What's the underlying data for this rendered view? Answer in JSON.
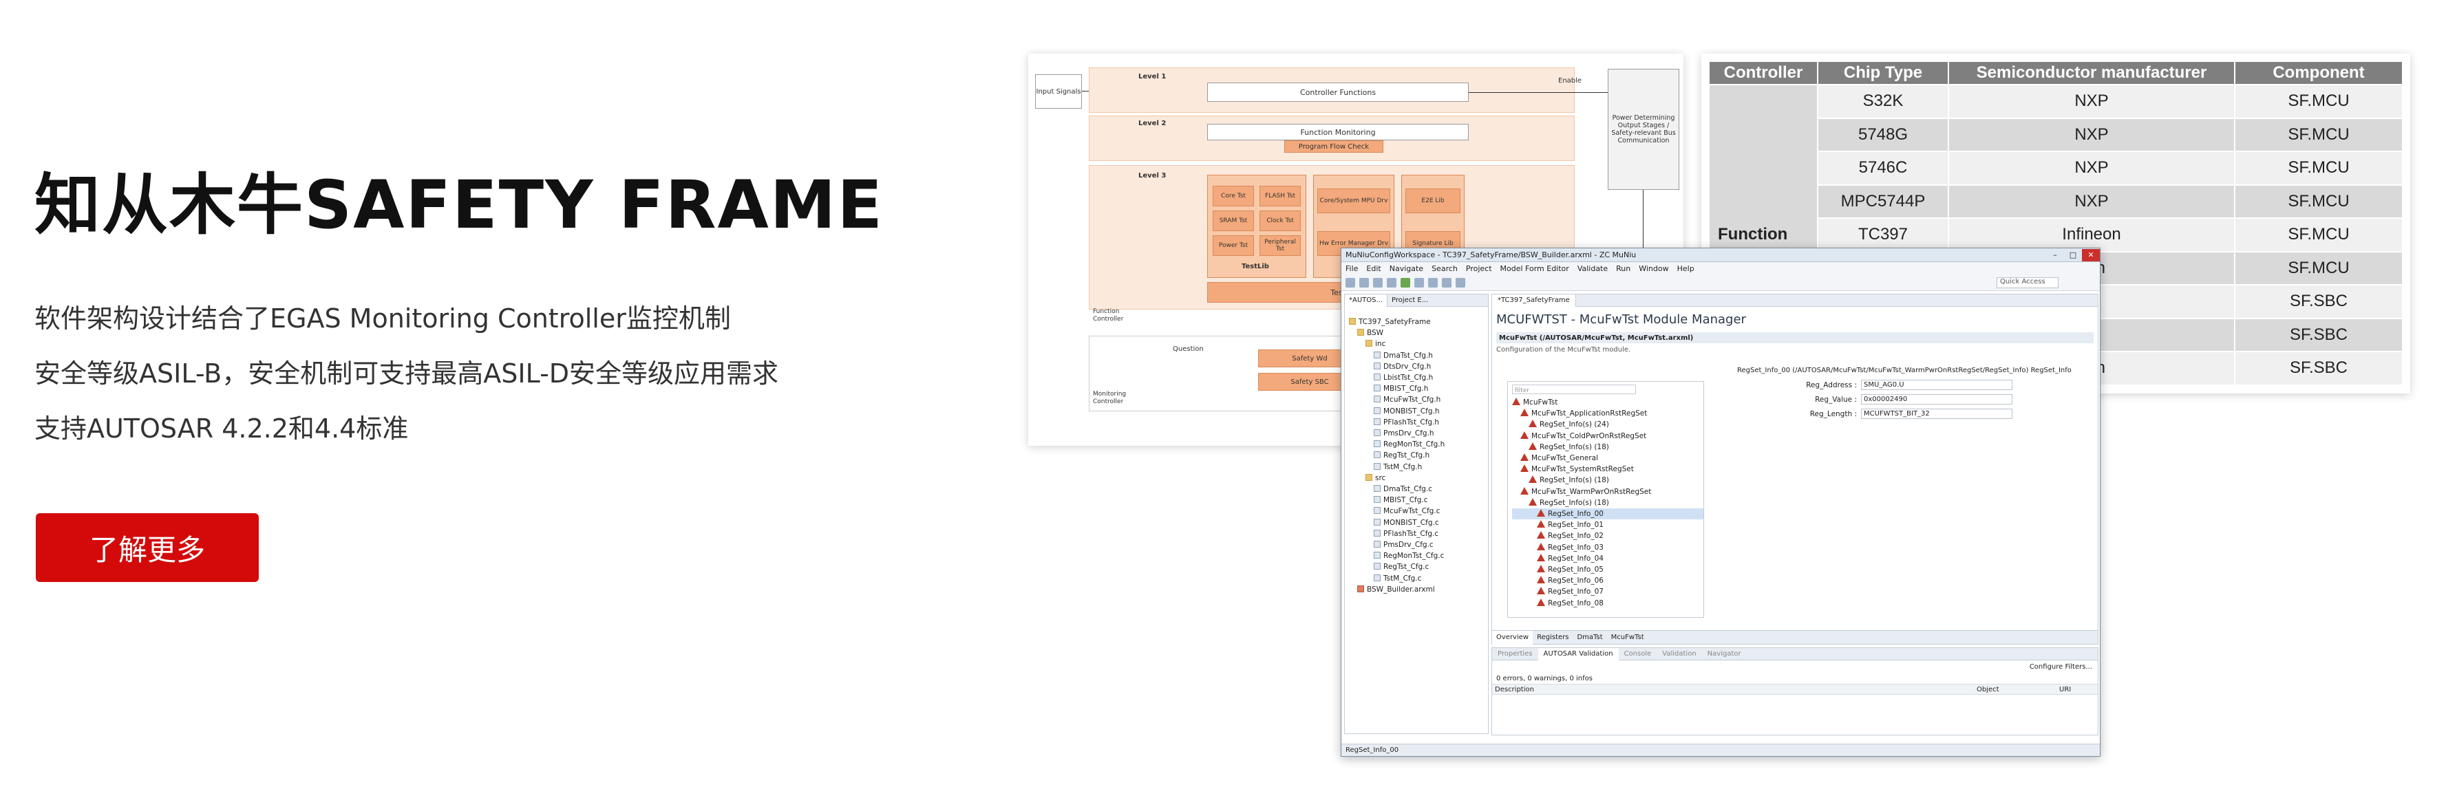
{
  "hero": {
    "title": "知从木牛SAFETY FRAME",
    "lines": [
      "软件架构设计结合了EGAS Monitoring Controller监控机制",
      "安全等级ASIL-B，安全机制可支持最高ASIL-D安全等级应用需求",
      "支持AUTOSAR 4.2.2和4.4标准"
    ],
    "cta_label": "了解更多",
    "cta_color": "#d40a0a"
  },
  "diagram": {
    "input_signals": "Input Signals",
    "level1": "Level 1",
    "level2": "Level 2",
    "level3": "Level 3",
    "controller_functions": "Controller Functions",
    "function_monitoring": "Function Monitoring",
    "program_flow_check": "Program Flow Check",
    "enable": "Enable",
    "output_box": "Power Determining Output Stages / Safety-relevant Bus Communication",
    "testlib": "TestLib",
    "core_tst": "Core Tst",
    "flash_tst": "FLASH Tst",
    "sram_tst": "SRAM Tst",
    "clock_tst": "Clock Tst",
    "power_tst": "Power Tst",
    "peripheral_tst": "Peripheral Tst",
    "core_mpu": "Core/System MPU Drv",
    "hw_error": "Hw Error Manager Drv",
    "e2e_lib": "E2E Lib",
    "signature_lib": "Signature Lib",
    "test_manager": "Test Ma",
    "function_controller": "Function Controller",
    "question": "Question",
    "safety_wd": "Safety Wd",
    "safety_sbc": "Safety SBC",
    "monitoring_controller": "Monitoring Controller"
  },
  "chip_table": {
    "headers": [
      "Controller",
      "Chip Type",
      "Semiconductor manufacturer",
      "Component"
    ],
    "group_label": "Function",
    "rows": [
      [
        "S32K",
        "NXP",
        "SF.MCU"
      ],
      [
        "5748G",
        "NXP",
        "SF.MCU"
      ],
      [
        "5746C",
        "NXP",
        "SF.MCU"
      ],
      [
        "MPC5744P",
        "NXP",
        "SF.MCU"
      ],
      [
        "TC397",
        "Infineon",
        "SF.MCU"
      ],
      [
        "",
        "eon",
        "SF.MCU"
      ],
      [
        "",
        "P",
        "SF.SBC"
      ],
      [
        "",
        "P",
        "SF.SBC"
      ],
      [
        "",
        "eon",
        "SF.SBC"
      ]
    ]
  },
  "ide": {
    "title": "MuNiuConfigWorkspace - TC397_SafetyFrame/BSW_Builder.arxml - ZC MuNiu",
    "menus": [
      "File",
      "Edit",
      "Navigate",
      "Search",
      "Project",
      "Model Form Editor",
      "Validate",
      "Run",
      "Window",
      "Help"
    ],
    "quick_access": "Quick Access",
    "left_tabs": [
      "*AUTOS...",
      "Project E..."
    ],
    "project_tree": [
      {
        "label": "TC397_SafetyFrame",
        "type": "folder",
        "indent": 0
      },
      {
        "label": "BSW",
        "type": "folder",
        "indent": 1
      },
      {
        "label": "inc",
        "type": "folder",
        "indent": 2
      },
      {
        "label": "DmaTst_Cfg.h",
        "type": "file",
        "indent": 3
      },
      {
        "label": "DtsDrv_Cfg.h",
        "type": "file",
        "indent": 3
      },
      {
        "label": "LbistTst_Cfg.h",
        "type": "file",
        "indent": 3
      },
      {
        "label": "MBIST_Cfg.h",
        "type": "file",
        "indent": 3
      },
      {
        "label": "McuFwTst_Cfg.h",
        "type": "file",
        "indent": 3
      },
      {
        "label": "MONBIST_Cfg.h",
        "type": "file",
        "indent": 3
      },
      {
        "label": "PFlashTst_Cfg.h",
        "type": "file",
        "indent": 3
      },
      {
        "label": "PmsDrv_Cfg.h",
        "type": "file",
        "indent": 3
      },
      {
        "label": "RegMonTst_Cfg.h",
        "type": "file",
        "indent": 3
      },
      {
        "label": "RegTst_Cfg.h",
        "type": "file",
        "indent": 3
      },
      {
        "label": "TstM_Cfg.h",
        "type": "file",
        "indent": 3
      },
      {
        "label": "src",
        "type": "folder",
        "indent": 2
      },
      {
        "label": "DmaTst_Cfg.c",
        "type": "file",
        "indent": 3
      },
      {
        "label": "MBIST_Cfg.c",
        "type": "file",
        "indent": 3
      },
      {
        "label": "McuFwTst_Cfg.c",
        "type": "file",
        "indent": 3
      },
      {
        "label": "MONBIST_Cfg.c",
        "type": "file",
        "indent": 3
      },
      {
        "label": "PFlashTst_Cfg.c",
        "type": "file",
        "indent": 3
      },
      {
        "label": "PmsDrv_Cfg.c",
        "type": "file",
        "indent": 3
      },
      {
        "label": "RegMonTst_Cfg.c",
        "type": "file",
        "indent": 3
      },
      {
        "label": "RegTst_Cfg.c",
        "type": "file",
        "indent": 3
      },
      {
        "label": "TstM_Cfg.c",
        "type": "file",
        "indent": 3
      },
      {
        "label": "BSW_Builder.arxml",
        "type": "xml",
        "indent": 1
      }
    ],
    "editor_tab": "*TC397_SafetyFrame",
    "module_title": "MCUFWTST - McuFwTst Module Manager",
    "module_path": "McuFwTst (/AUTOSAR/McuFwTst, McuFwTst.arxml)",
    "module_desc": "Configuration of the McuFwTst module.",
    "filter_placeholder": "filter",
    "module_tree": [
      {
        "label": "McuFwTst",
        "indent": 0,
        "sel": false
      },
      {
        "label": "McuFwTst_ApplicationRstRegSet",
        "indent": 1,
        "sel": false
      },
      {
        "label": "RegSet_Info(s) (24)",
        "indent": 2,
        "sel": false
      },
      {
        "label": "McuFwTst_ColdPwrOnRstRegSet",
        "indent": 1,
        "sel": false
      },
      {
        "label": "RegSet_Info(s) (18)",
        "indent": 2,
        "sel": false
      },
      {
        "label": "McuFwTst_General",
        "indent": 1,
        "sel": false
      },
      {
        "label": "McuFwTst_SystemRstRegSet",
        "indent": 1,
        "sel": false
      },
      {
        "label": "RegSet_Info(s) (18)",
        "indent": 2,
        "sel": false
      },
      {
        "label": "McuFwTst_WarmPwrOnRstRegSet",
        "indent": 1,
        "sel": false
      },
      {
        "label": "RegSet_Info(s) (18)",
        "indent": 2,
        "sel": false
      },
      {
        "label": "RegSet_Info_00",
        "indent": 3,
        "sel": true
      },
      {
        "label": "RegSet_Info_01",
        "indent": 3,
        "sel": false
      },
      {
        "label": "RegSet_Info_02",
        "indent": 3,
        "sel": false
      },
      {
        "label": "RegSet_Info_03",
        "indent": 3,
        "sel": false
      },
      {
        "label": "RegSet_Info_04",
        "indent": 3,
        "sel": false
      },
      {
        "label": "RegSet_Info_05",
        "indent": 3,
        "sel": false
      },
      {
        "label": "RegSet_Info_06",
        "indent": 3,
        "sel": false
      },
      {
        "label": "RegSet_Info_07",
        "indent": 3,
        "sel": false
      },
      {
        "label": "RegSet_Info_08",
        "indent": 3,
        "sel": false
      }
    ],
    "props_header": "RegSet_Info_00 (/AUTOSAR/McuFwTst/McuFwTst_WarmPwrOnRstRegSet/RegSet_Info) RegSet_Info",
    "props": [
      {
        "label": "Reg_Address :",
        "value": "SMU_AG0.U"
      },
      {
        "label": "Reg_Value :",
        "value": "0x00002490"
      },
      {
        "label": "Reg_Length :",
        "value": "MCUFWTST_BIT_32"
      }
    ],
    "editor_bottom_tabs": [
      "Overview",
      "Registers",
      "DmaTst",
      "McuFwTst"
    ],
    "view_tabs": [
      "Properties",
      "AUTOSAR Validation",
      "Console",
      "Validation",
      "Navigator"
    ],
    "configure_filters": "Configure Filters...",
    "validation_count": "0 errors, 0 warnings, 0 infos",
    "validation_columns": [
      "Description",
      "Object",
      "URI"
    ],
    "status_text": "RegSet_Info_00"
  }
}
